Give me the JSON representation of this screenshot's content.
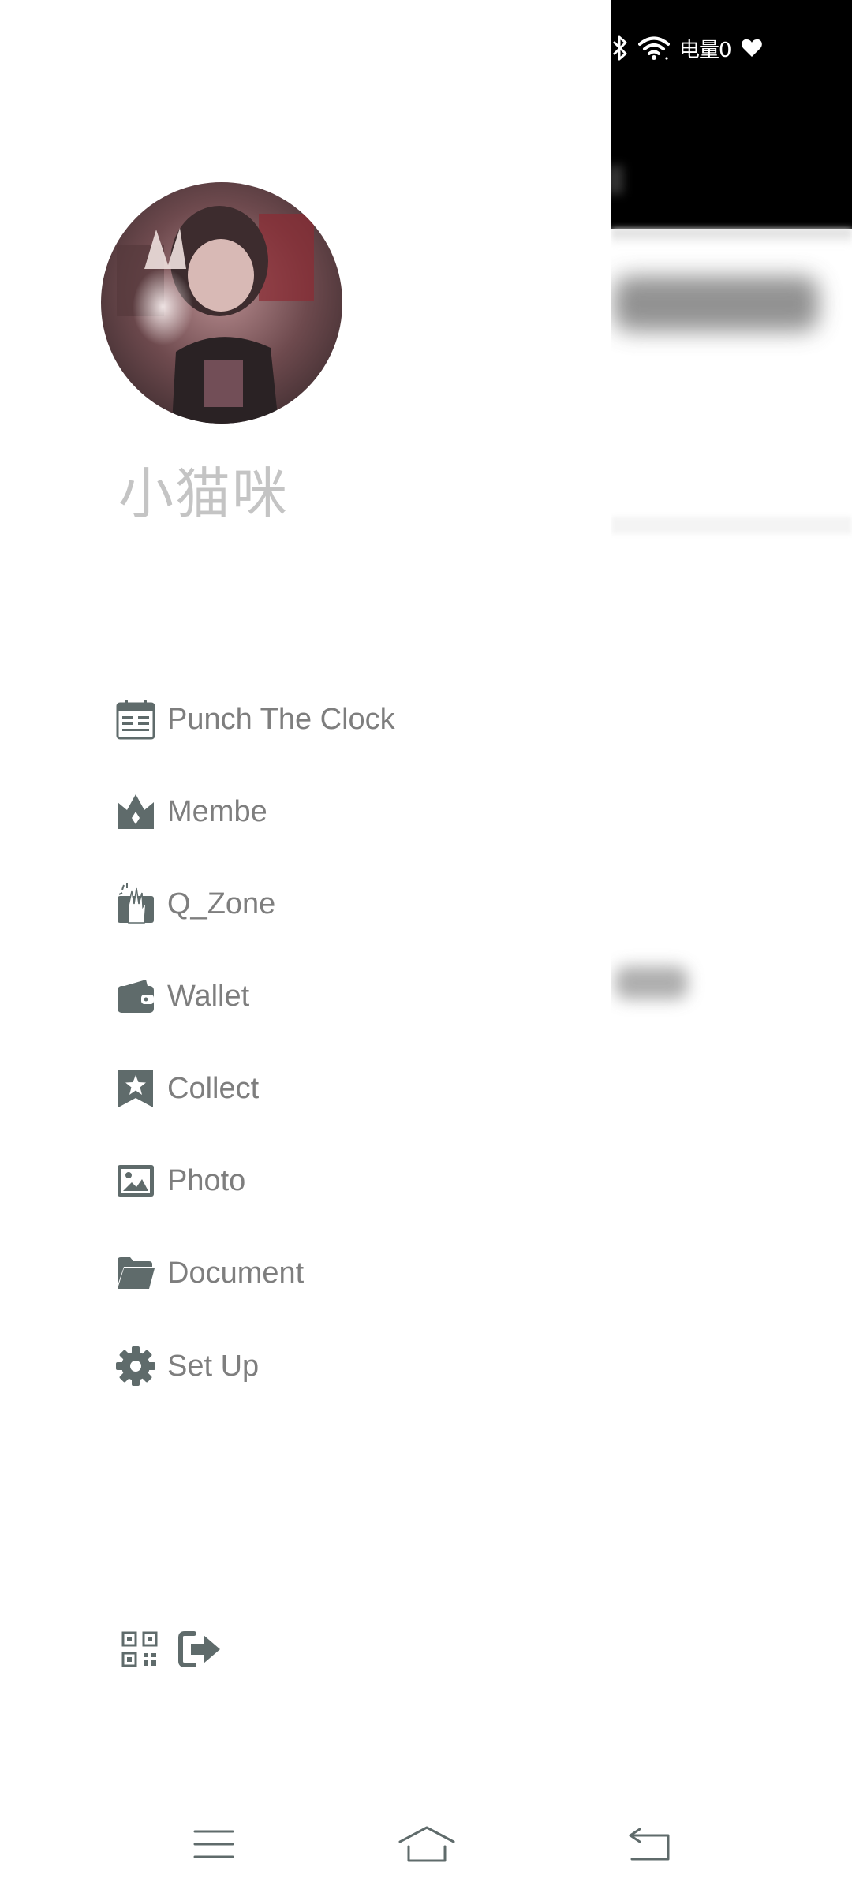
{
  "status_bar": {
    "battery_text": "电量0",
    "icons": [
      "bluetooth-icon",
      "wifi-icon",
      "heart-icon"
    ]
  },
  "profile": {
    "username": "小猫咪",
    "avatar": "avatar-image"
  },
  "menu": {
    "items": [
      {
        "label": "Punch The Clock",
        "icon": "calendar-icon"
      },
      {
        "label": "Membe",
        "icon": "crown-icon"
      },
      {
        "label": "Q_Zone",
        "icon": "qzone-hand-icon"
      },
      {
        "label": "Wallet",
        "icon": "wallet-icon"
      },
      {
        "label": "Collect",
        "icon": "bookmark-star-icon"
      },
      {
        "label": "Photo",
        "icon": "photo-icon"
      },
      {
        "label": "Document",
        "icon": "folder-icon"
      },
      {
        "label": "Set Up",
        "icon": "gear-icon"
      }
    ]
  },
  "footer": {
    "icons": [
      "qr-code-icon",
      "logout-icon"
    ]
  },
  "nav_bar": {
    "icons": [
      "menu-icon",
      "home-icon",
      "back-icon"
    ]
  },
  "colors": {
    "icon": "#5f6b6b",
    "label": "#7e7e7e",
    "username": "#c4c4c4",
    "header_bg": "#000000"
  }
}
